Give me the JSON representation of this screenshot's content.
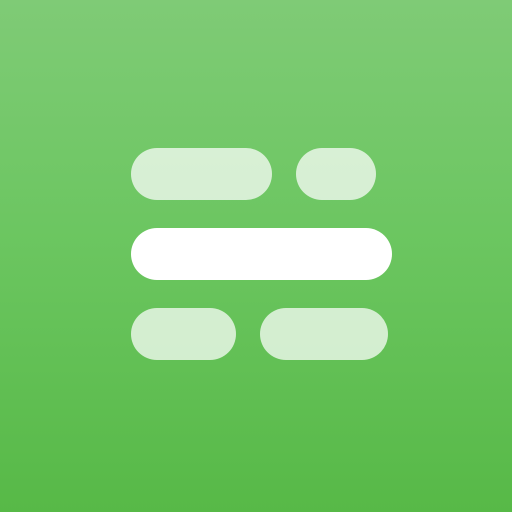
{
  "icon": {
    "name": "app-icon",
    "gradient_top": "#7fcb76",
    "gradient_bottom": "#57b947",
    "pill_muted_color": "#d6ecd2",
    "pill_solid_color": "#ffffff"
  }
}
